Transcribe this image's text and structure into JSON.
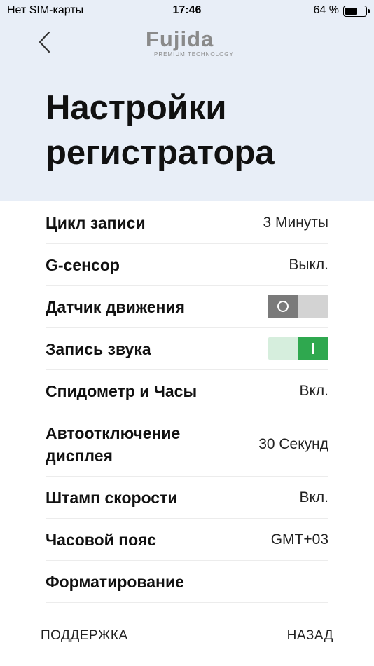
{
  "status_bar": {
    "carrier": "Нет SIM-карты",
    "time": "17:46",
    "battery_text": "64 %",
    "battery_level": 0.64
  },
  "header": {
    "back_icon": "chevron-left-icon",
    "logo_text": "Fujida",
    "logo_subtext": "PREMIUM TECHNOLOGY",
    "title": "Настройки регистратора"
  },
  "settings": [
    {
      "label": "Цикл записи",
      "value": "3 Минуты"
    },
    {
      "label": "G-сенсор",
      "value": "Выкл."
    },
    {
      "label": "Датчик движения",
      "toggle": "off"
    },
    {
      "label": "Запись звука",
      "toggle": "on"
    },
    {
      "label": "Спидометр и Часы",
      "value": "Вкл."
    },
    {
      "label": "Автоотключение дисплея",
      "value": "30 Секунд"
    },
    {
      "label": "Штамп скорости",
      "value": "Вкл."
    },
    {
      "label": "Часовой пояс",
      "value": "GMT+03"
    },
    {
      "label": "Форматирование",
      "value": ""
    }
  ],
  "footer": {
    "support_label": "ПОДДЕРЖКА",
    "back_label": "НАЗАД"
  },
  "colors": {
    "header_background": "#e8eef7",
    "toggle_on": "#2fa84f",
    "toggle_off": "#7a7a7a"
  }
}
